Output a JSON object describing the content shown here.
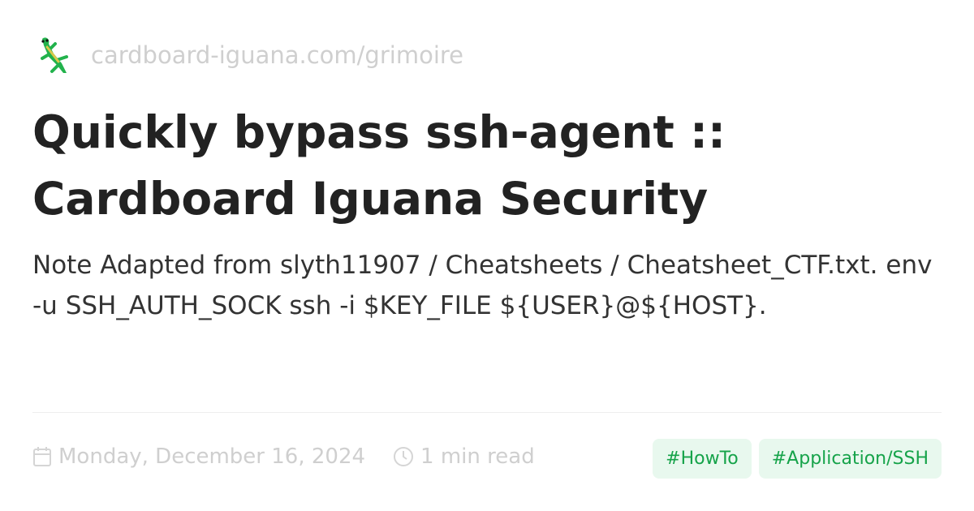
{
  "site": {
    "url": "cardboard-iguana.com/grimoire",
    "logo_icon": "lizard-emoji"
  },
  "title": "Quickly bypass ssh-agent :: Cardboard Iguana Security",
  "description": "Note Adapted from slyth11907 / Cheatsheets / Cheatsheet_CTF.txt. env -u SSH_AUTH_SOCK ssh -i $KEY_FILE ${USER}@${HOST}.",
  "meta": {
    "date": "Monday, December 16, 2024",
    "read_time": "1 min read"
  },
  "tags": [
    "#HowTo",
    "#Application/SSH"
  ],
  "colors": {
    "tag_bg": "#e8f8ee",
    "tag_text": "#16a34a"
  }
}
